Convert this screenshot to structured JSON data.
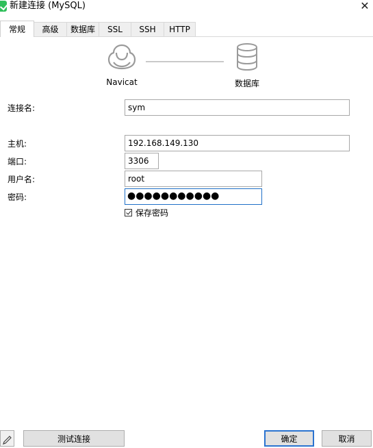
{
  "window": {
    "title": "新建连接 (MySQL)",
    "close_glyph": "✕"
  },
  "tabs": [
    {
      "label": "常规",
      "active": true
    },
    {
      "label": "高级",
      "active": false
    },
    {
      "label": "数据库",
      "active": false
    },
    {
      "label": "SSL",
      "active": false
    },
    {
      "label": "SSH",
      "active": false
    },
    {
      "label": "HTTP",
      "active": false
    }
  ],
  "diagram": {
    "left_label": "Navicat",
    "right_label": "数据库",
    "left_icon": "navicat-logo-icon",
    "right_icon": "database-icon"
  },
  "form": {
    "connection_name": {
      "label": "连接名:",
      "value": "sym"
    },
    "host": {
      "label": "主机:",
      "value": "192.168.149.130"
    },
    "port": {
      "label": "端口:",
      "value": "3306"
    },
    "username": {
      "label": "用户名:",
      "value": "root"
    },
    "password": {
      "label": "密码:",
      "value": "●●●●●●●●●●●"
    },
    "save_password": {
      "label": "保存密码",
      "checked": true
    }
  },
  "buttons": {
    "test_connection": "测试连接",
    "ok": "确定",
    "cancel": "取消"
  },
  "colors": {
    "focus_border": "#1e6fc7",
    "app_icon": "#2fbf5a",
    "primary_button_border": "#2a73d0"
  }
}
